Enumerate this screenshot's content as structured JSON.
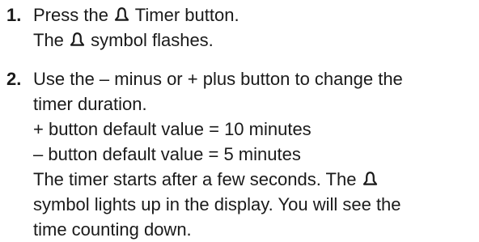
{
  "steps": [
    {
      "number": "1.",
      "lines": [
        {
          "before": "Press the",
          "icon": "bell-icon",
          "after": "Timer button."
        },
        {
          "before": "The",
          "icon": "bell-icon",
          "after": "symbol flashes."
        }
      ]
    },
    {
      "number": "2.",
      "lines": [
        {
          "text": "Use the – minus or + plus button to change the"
        },
        {
          "text": "timer duration."
        },
        {
          "text": "+ button default value = 10 minutes"
        },
        {
          "text": "– button default value = 5 minutes"
        },
        {
          "before": "The timer starts after a few seconds. The",
          "icon": "bell-icon",
          "after": ""
        },
        {
          "text": "symbol lights up in the display. You will see the"
        },
        {
          "text": "time counting down."
        }
      ]
    }
  ]
}
